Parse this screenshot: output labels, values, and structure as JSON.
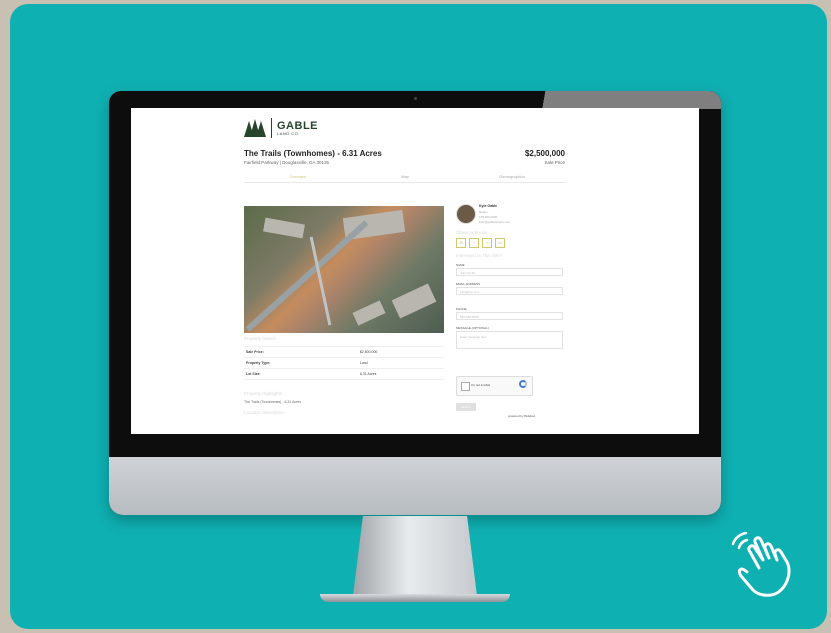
{
  "listing": {
    "logo_name": "GABLE",
    "logo_sub": "LAND CO.",
    "title": "The Trails (Townhomes) - 6.31 Acres",
    "address": "Fairfield Parkway | Douglasville, GA 30135",
    "price": "$2,500,000",
    "price_label": "Sale Price",
    "tabs": [
      "Overview",
      "Map",
      "Demographics"
    ]
  },
  "details": {
    "heading": "Property Details",
    "rows": [
      {
        "label": "Sale Price:",
        "value": "$2,500,000"
      },
      {
        "label": "Property Type:",
        "value": "Land"
      },
      {
        "label": "Lot Size:",
        "value": "6.31 Acres"
      }
    ],
    "highlights_heading": "Property Highlights",
    "highlight_1": "The Trails (Townhomes) - 6.31 Acres",
    "location_heading": "Location Description"
  },
  "contact": {
    "agent_name": "Kyle Gable",
    "agent_role": "Broker",
    "agent_phone": "678.000.0000",
    "agent_email": "kyle@gablelandco.com",
    "share_heading": "Share to Social",
    "form_heading": "Interested In This Site?",
    "name_label": "NAME",
    "name_placeholder": "John Smith",
    "email_label": "EMAIL ADDRESS",
    "email_placeholder": "john@cre.com",
    "phone_label": "PHONE",
    "phone_placeholder": "555-555-5555",
    "message_label": "MESSAGE (OPTIONAL)",
    "message_placeholder": "Enter message here",
    "captcha_label": "I'm not a robot",
    "submit_label": "Submit",
    "powered_by": "powered by Buildout"
  }
}
